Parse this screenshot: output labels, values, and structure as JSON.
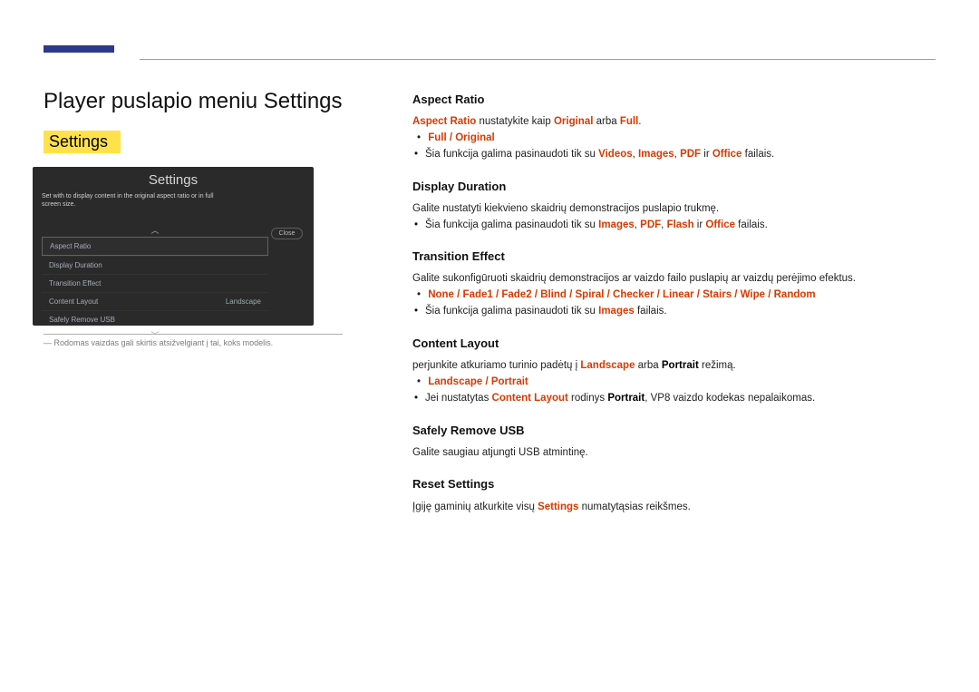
{
  "page": {
    "title": "Player puslapio meniu Settings",
    "subhead": "Settings"
  },
  "panel": {
    "title": "Settings",
    "label_pre": "Set ",
    "label_bold1": "with",
    "label_mid": " to display content in ",
    "label_bold2": "the",
    "label_suf": " original aspect ratio or in full screen size.",
    "rows": {
      "r0": "Aspect Ratio",
      "r1": "Display Duration",
      "r2": "Transition Effect",
      "r3": "Content Layout",
      "r3v": "Landscape",
      "r4": "Safely Remove USB"
    },
    "close": "Close",
    "chev_up": "︿",
    "chev_dn": "﹀"
  },
  "footnote": "Rodomas vaizdas gali skirtis atsižvelgiant į tai, koks modelis.",
  "sections": {
    "aspect": {
      "h": "Aspect Ratio",
      "line1_a": "Aspect Ratio",
      "line1_b": " nustatykite kaip ",
      "line1_c": "Original",
      "line1_d": " arba ",
      "line1_e": "Full",
      "line1_f": ".",
      "dash": "•",
      "opt": "Full / Original",
      "n1a": "Šia funkcija galima pasinaudoti tik su ",
      "n1b": "Videos",
      "n1c": ", ",
      "n1d": "Images",
      "n1e": ", ",
      "n1f": "PDF",
      "n1g": " ir ",
      "n1h": "Office",
      "n1i": " failais."
    },
    "display": {
      "h": "Display Duration",
      "p": "Galite nustatyti kiekvieno skaidrių demonstracijos puslapio trukmę.",
      "n1a": "Šia funkcija galima pasinaudoti tik su ",
      "n1b": "Images",
      "n1c": ", ",
      "n1d": "PDF",
      "n1e": ", ",
      "n1f": "Flash",
      "n1g": " ir ",
      "n1h": "Office",
      "n1i": " failais."
    },
    "transition": {
      "h": "Transition Effect",
      "p": "Galite sukonfigūruoti skaidrių demonstracijos ar vaizdo failo puslapių ar vaizdų perėjimo efektus.",
      "dash": "•",
      "opt": "None / Fade1 / Fade2 / Blind / Spiral / Checker / Linear / Stairs / Wipe / Random",
      "n1a": "Šia funkcija galima pasinaudoti tik su ",
      "n1b": "Images",
      "n1c": " failais."
    },
    "content": {
      "h": "Content Layout",
      "p1": "perjunkite atkuriamo turinio padėtų į ",
      "p2": "Landscape",
      "p3": " arba ",
      "p4": "Portrait",
      "p5": " režimą.",
      "dash": "•",
      "opt": "Landscape / Portrait",
      "n1a": "Jei nustatytas ",
      "n1b": "Content Layout",
      "n1c": " rodinys ",
      "n1d": "Portrait",
      "n1e": ", VP8 vaizdo kodekas nepalaikomas."
    },
    "safely": {
      "h": "Safely Remove USB",
      "p": "Galite saugiau atjungti USB atmintinę."
    },
    "reset": {
      "h": "Reset Settings",
      "p1": "Įgiję  gaminių atkurkite visų ",
      "p2": "Settings",
      "p3": " numatytąsias reikšmes."
    }
  }
}
